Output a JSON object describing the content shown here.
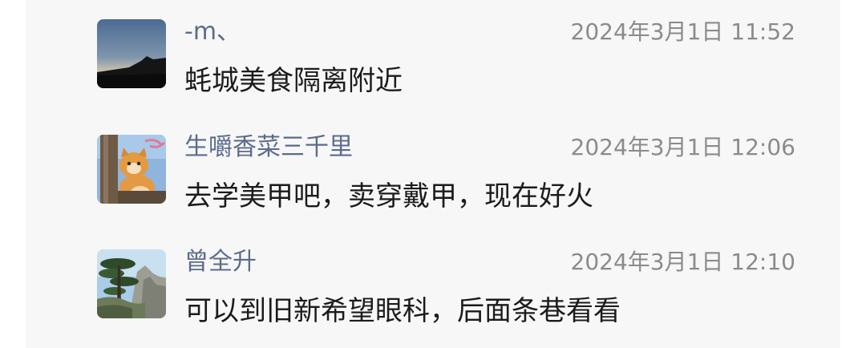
{
  "comments": [
    {
      "author": "-m、",
      "time": "2024年3月1日 11:52",
      "text": "蚝城美食隔离附近"
    },
    {
      "author": "生嚼香菜三千里",
      "time": "2024年3月1日 12:06",
      "text": "去学美甲吧，卖穿戴甲，现在好火"
    },
    {
      "author": "曾全升",
      "time": "2024年3月1日 12:10",
      "text": "可以到旧新希望眼科，后面条巷看看"
    }
  ]
}
